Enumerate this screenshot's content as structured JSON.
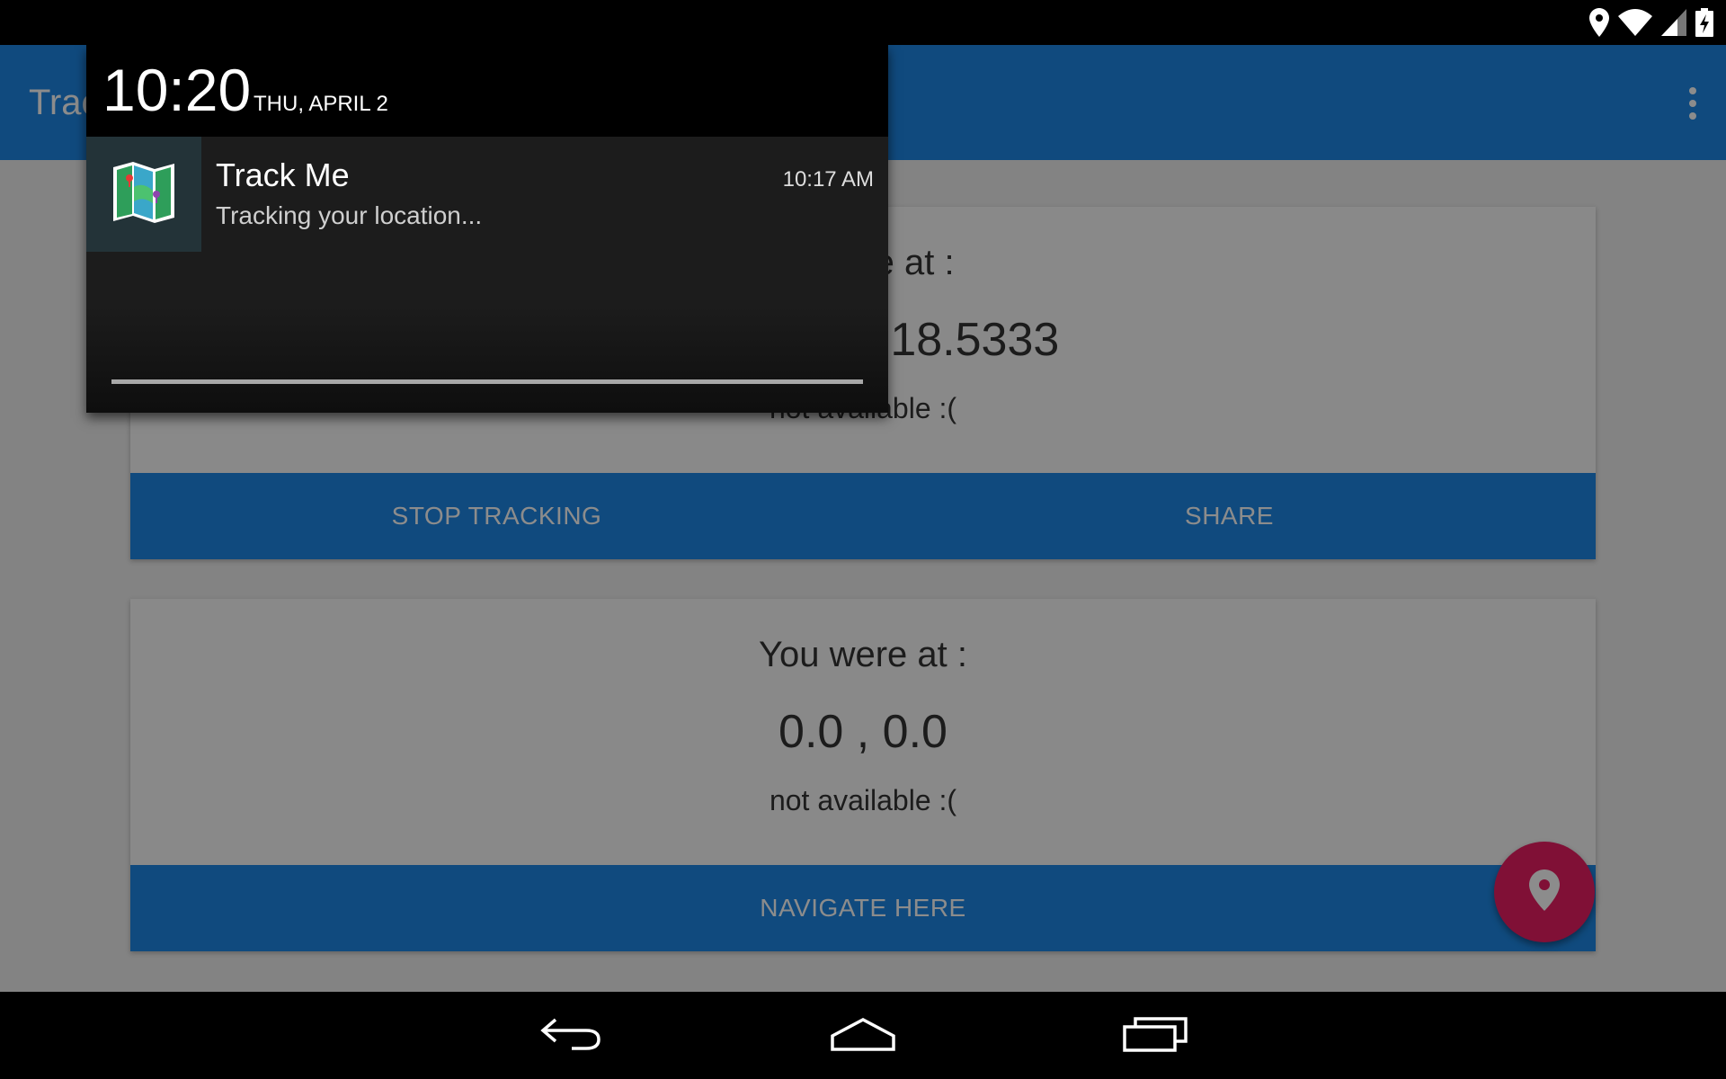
{
  "status_bar": {
    "icons": [
      "location-icon",
      "wifi-icon",
      "signal-icon",
      "battery-charging-icon"
    ]
  },
  "app_bar": {
    "title": "Track Me",
    "overflow_icon": "more-vert-icon"
  },
  "current_card": {
    "heading": "You are at :",
    "coords": "65.9667 , -18.5333",
    "address": "not available :(",
    "buttons": {
      "stop": "STOP TRACKING",
      "share": "SHARE"
    }
  },
  "previous_card": {
    "heading": "You were at :",
    "coords": "0.0 , 0.0",
    "address": "not available :(",
    "buttons": {
      "navigate": "NAVIGATE HERE"
    }
  },
  "fab": {
    "icon": "map-pin-icon"
  },
  "notification_shade": {
    "time": "10:20",
    "date": "THU, APRIL 2",
    "notification": {
      "app_icon": "folded-map-icon",
      "title": "Track Me",
      "time": "10:17 AM",
      "text": "Tracking your location..."
    }
  },
  "nav_bar": {
    "icons": [
      "back-icon",
      "home-icon",
      "recents-icon"
    ]
  },
  "colors": {
    "primary": "#1e88e5",
    "accent": "#e91e63",
    "background": "#eeeeee"
  }
}
